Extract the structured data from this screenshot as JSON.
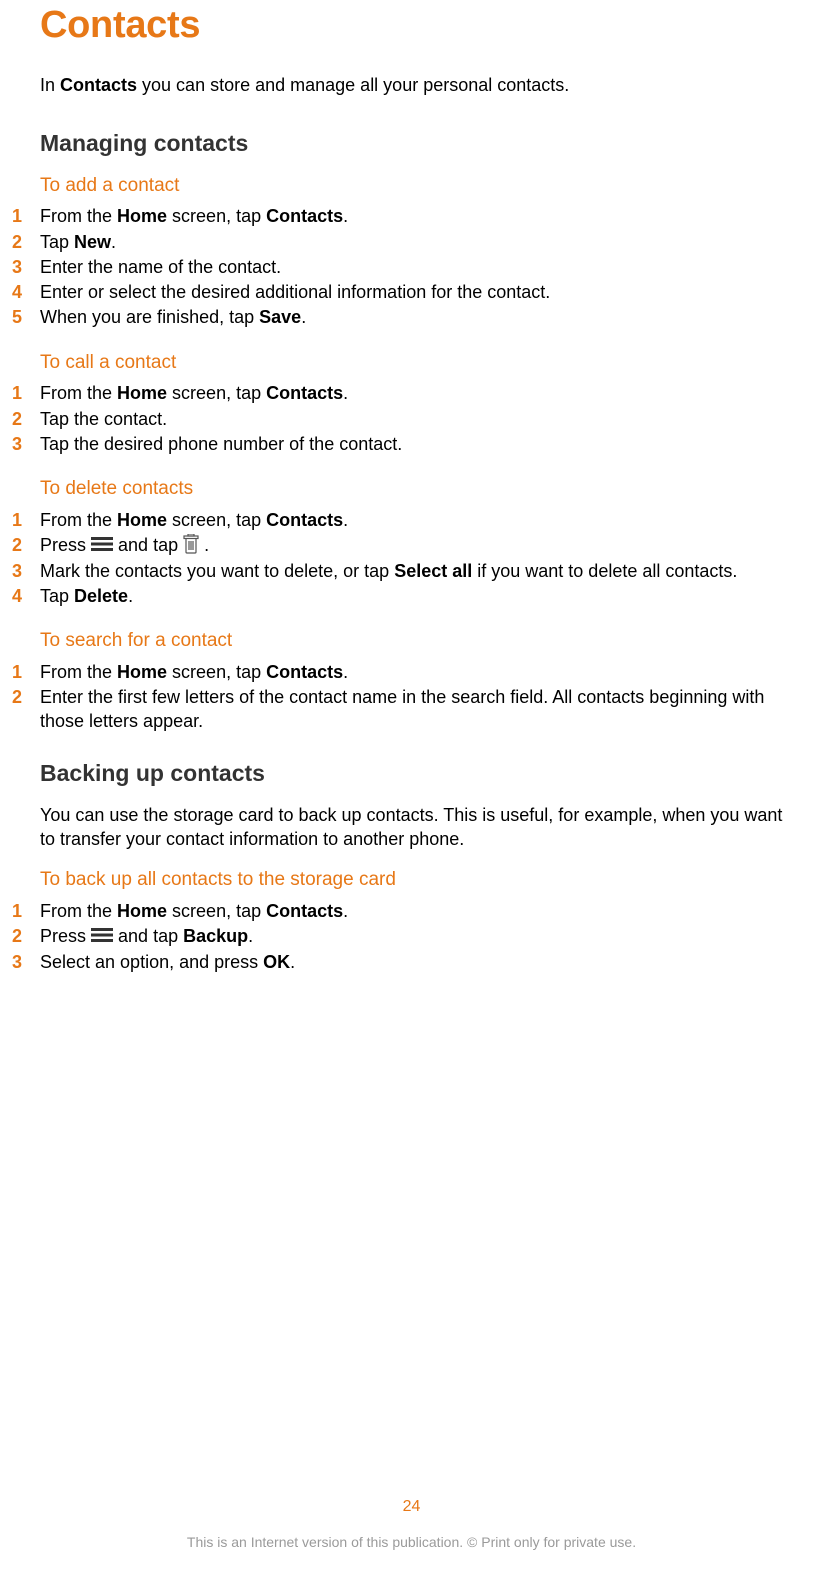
{
  "title": "Contacts",
  "intro": {
    "p1a": "In ",
    "p1b": "Contacts",
    "p1c": " you can store and manage all your personal contacts."
  },
  "sections": {
    "managing": {
      "heading": "Managing contacts",
      "tasks": {
        "add": {
          "title": "To add a contact",
          "s1a": "From the ",
          "s1b": "Home",
          "s1c": " screen, tap ",
          "s1d": "Contacts",
          "s1e": ".",
          "s2a": "Tap ",
          "s2b": "New",
          "s2c": ".",
          "s3": "Enter the name of the contact.",
          "s4": "Enter or select the desired additional information for the contact.",
          "s5a": "When you are finished, tap ",
          "s5b": "Save",
          "s5c": "."
        },
        "call": {
          "title": "To call a contact",
          "s1a": "From the ",
          "s1b": "Home",
          "s1c": " screen, tap ",
          "s1d": "Contacts",
          "s1e": ".",
          "s2": "Tap the contact.",
          "s3": "Tap the desired phone number of the contact."
        },
        "delete": {
          "title": "To delete contacts",
          "s1a": "From the ",
          "s1b": "Home",
          "s1c": " screen, tap ",
          "s1d": "Contacts",
          "s1e": ".",
          "s2a": "Press ",
          "s2b": " and tap ",
          "s2c": " .",
          "s3a": "Mark the contacts you want to delete, or tap ",
          "s3b": "Select all",
          "s3c": " if you want to delete all contacts.",
          "s4a": "Tap ",
          "s4b": "Delete",
          "s4c": "."
        },
        "search": {
          "title": "To search for a contact",
          "s1a": "From the ",
          "s1b": "Home",
          "s1c": " screen, tap ",
          "s1d": "Contacts",
          "s1e": ".",
          "s2": "Enter the first few letters of the contact name in the search field. All contacts beginning with those letters appear."
        }
      }
    },
    "backup": {
      "heading": "Backing up contacts",
      "intro": "You can use the storage card to back up contacts. This is useful, for example, when you want to transfer your contact information to another phone.",
      "tasks": {
        "backup_all": {
          "title": "To back up all contacts to the storage card",
          "s1a": "From the ",
          "s1b": "Home",
          "s1c": " screen, tap ",
          "s1d": "Contacts",
          "s1e": ".",
          "s2a": "Press ",
          "s2b": " and tap ",
          "s2c": "Backup",
          "s2d": ".",
          "s3a": "Select an option, and press ",
          "s3b": "OK",
          "s3c": "."
        }
      }
    }
  },
  "footer": {
    "page": "24",
    "note": "This is an Internet version of this publication. © Print only for private use."
  },
  "numbers": {
    "n1": "1",
    "n2": "2",
    "n3": "3",
    "n4": "4",
    "n5": "5"
  }
}
